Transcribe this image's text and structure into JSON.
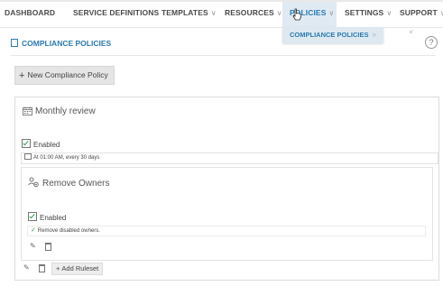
{
  "nav": {
    "items": [
      {
        "label": "DASHBOARD",
        "chevron": false
      },
      {
        "label": "SERVICE DEFINITIONS",
        "chevron": false
      },
      {
        "label": "TEMPLATES",
        "chevron": true
      },
      {
        "label": "RESOURCES",
        "chevron": true
      },
      {
        "label": "POLICIES",
        "chevron": true
      },
      {
        "label": "SETTINGS",
        "chevron": true
      },
      {
        "label": "SUPPORT",
        "chevron": true
      }
    ],
    "chevron_glyph": "∨",
    "active_item": "POLICIES",
    "dropdown": {
      "item_label": "COMPLIANCE POLICIES",
      "item_chevron": ">"
    }
  },
  "header": {
    "title": "COMPLIANCE POLICIES",
    "help_glyph": "?",
    "small_mark": "≡′"
  },
  "toolbar": {
    "new_policy_label": "New Compliance Policy",
    "plus_glyph": "+"
  },
  "policy": {
    "title": "Monthly review",
    "enabled_label": "Enabled",
    "schedule_text": "At 01:00 AM, every 30 days",
    "ruleset": {
      "title": "Remove Owners",
      "enabled_label": "Enabled",
      "rule_text": "Remove disabled owners.",
      "ok_glyph": "✓"
    },
    "add_ruleset_label": "Add Ruleset",
    "edit_glyph": "✎"
  },
  "colors": {
    "accent": "#2a7ab0",
    "check": "#2f9a4a",
    "button_bg": "#e5e5e5"
  }
}
